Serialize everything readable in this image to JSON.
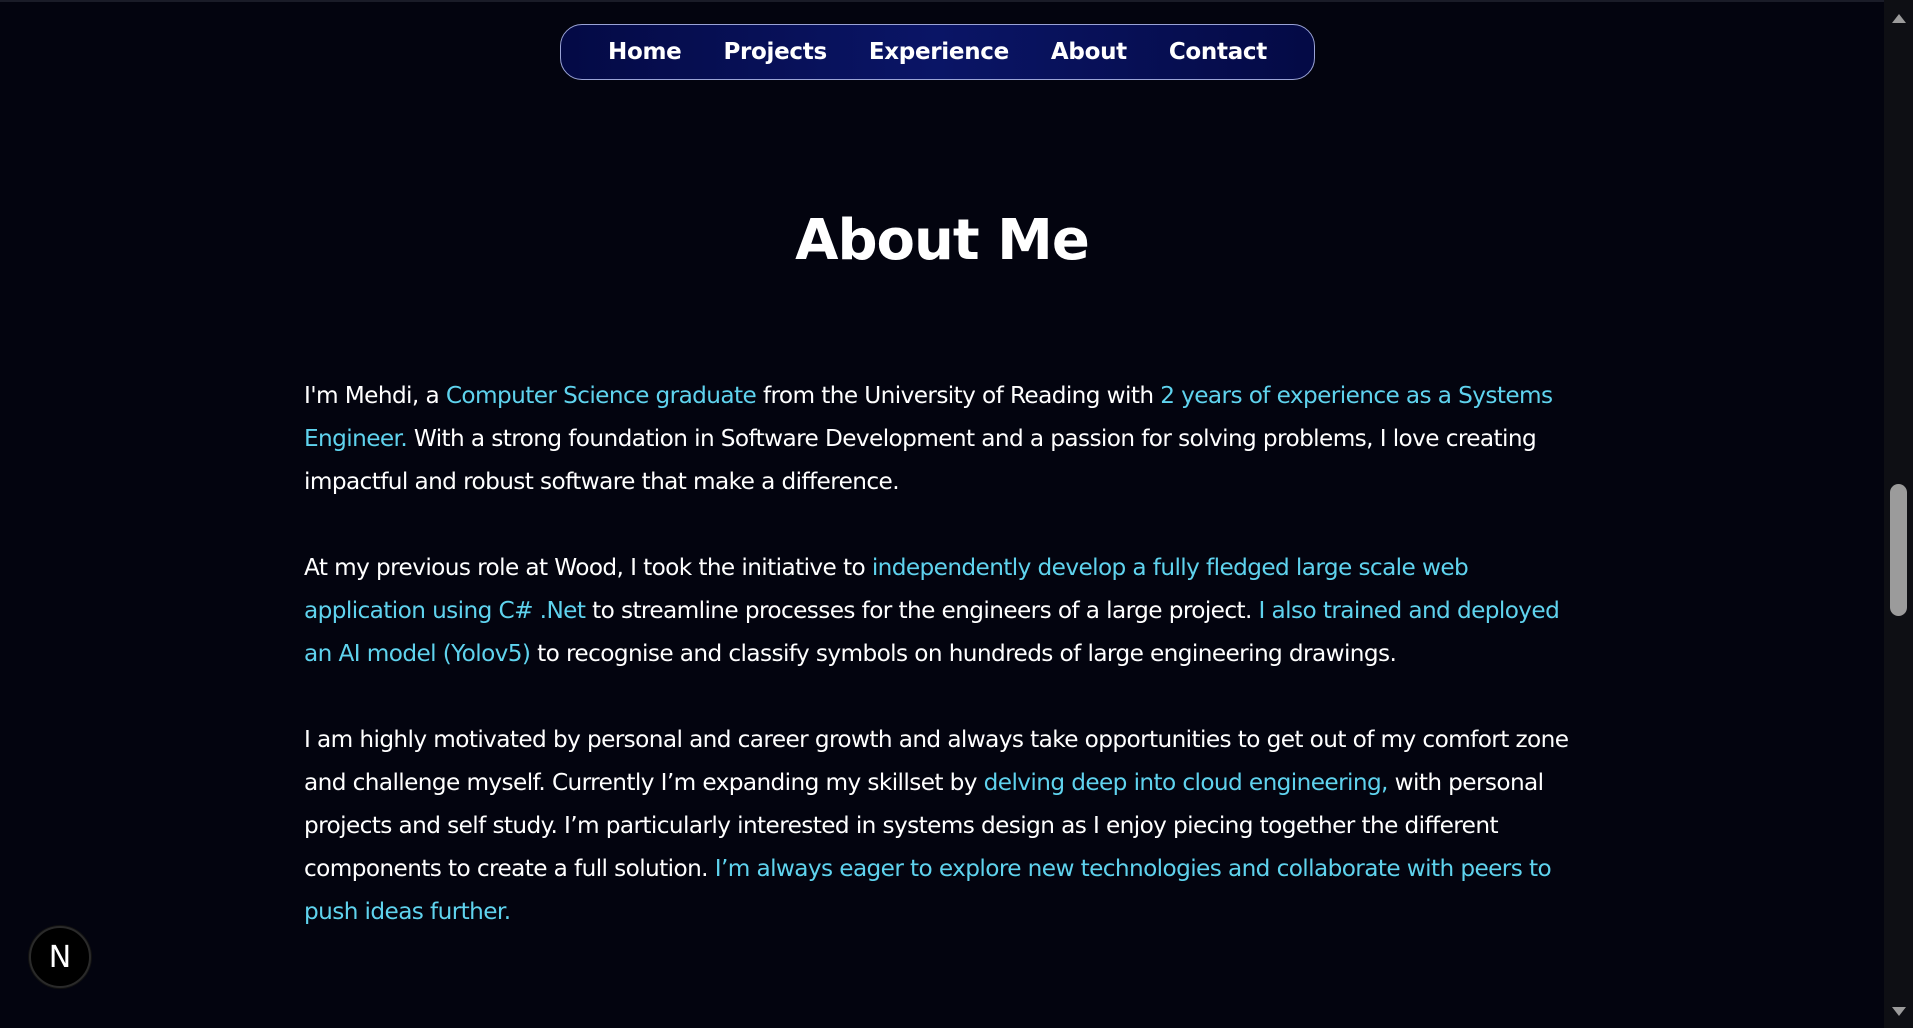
{
  "nav": {
    "items": [
      {
        "label": "Home"
      },
      {
        "label": "Projects"
      },
      {
        "label": "Experience"
      },
      {
        "label": "About"
      },
      {
        "label": "Contact"
      }
    ]
  },
  "about": {
    "title": "About Me",
    "p1": [
      {
        "text": "I'm Mehdi, a ",
        "hl": false
      },
      {
        "text": "Computer Science graduate",
        "hl": true
      },
      {
        "text": " from the University of Reading with ",
        "hl": false
      },
      {
        "text": "2 years of experience as a Systems Engineer.",
        "hl": true
      },
      {
        "text": " With a strong foundation in Software Development and a passion for solving problems, I love creating impactful and robust software that make a difference.",
        "hl": false
      }
    ],
    "p2": [
      {
        "text": "At my previous role at Wood, I took the initiative to ",
        "hl": false
      },
      {
        "text": "independently develop a fully fledged large scale web application using C# .Net",
        "hl": true
      },
      {
        "text": " to streamline processes for the engineers of a large project. ",
        "hl": false
      },
      {
        "text": "I also trained and deployed an AI model (Yolov5)",
        "hl": true
      },
      {
        "text": " to recognise and classify symbols on hundreds of large engineering drawings.",
        "hl": false
      }
    ],
    "p3": [
      {
        "text": "I am highly motivated by personal and career growth and always take opportunities to get out of my comfort zone and challenge myself. Currently I’m expanding my skillset by ",
        "hl": false
      },
      {
        "text": "delving deep into cloud engineering,",
        "hl": true
      },
      {
        "text": " with personal projects and self study. I’m particularly interested in systems design as I enjoy piecing together the different components to create a full solution. ",
        "hl": false
      },
      {
        "text": "I’m always eager to explore new technologies and collaborate with peers to push ideas further.",
        "hl": true
      }
    ]
  },
  "badge": {
    "letter": "N"
  },
  "colors": {
    "background": "#03040f",
    "accent": "#5fd3ee",
    "nav_bg": "#0a1566",
    "text": "#ffffff"
  }
}
